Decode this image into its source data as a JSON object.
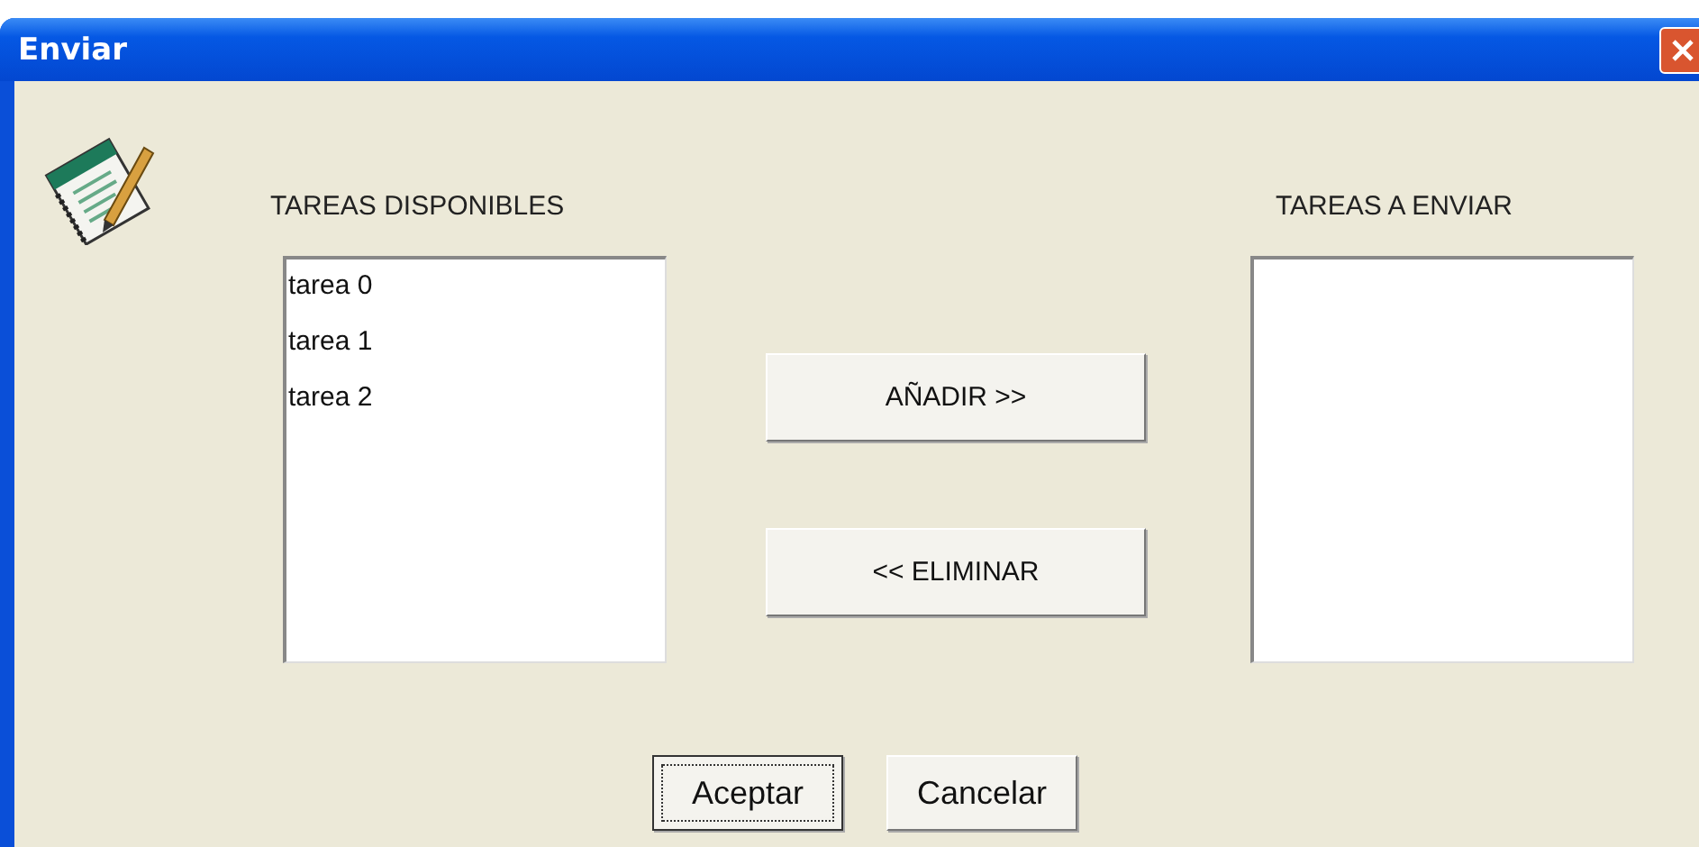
{
  "window": {
    "title": "Enviar"
  },
  "available": {
    "label": "TAREAS DISPONIBLES",
    "items": [
      {
        "text": "tarea 0",
        "selected": false
      },
      {
        "text": "tarea 1",
        "selected": false
      },
      {
        "text": "tarea 2",
        "selected": false
      }
    ]
  },
  "move_buttons": [
    {
      "label": "AÑADIR >>"
    },
    {
      "label": "<< ELIMINAR"
    }
  ],
  "to_send": {
    "label": "TAREAS A ENVIAR"
  },
  "buttons": [
    {
      "label": "Aceptar",
      "focused": true
    },
    {
      "label": "Cancelar",
      "focused": false
    }
  ]
}
